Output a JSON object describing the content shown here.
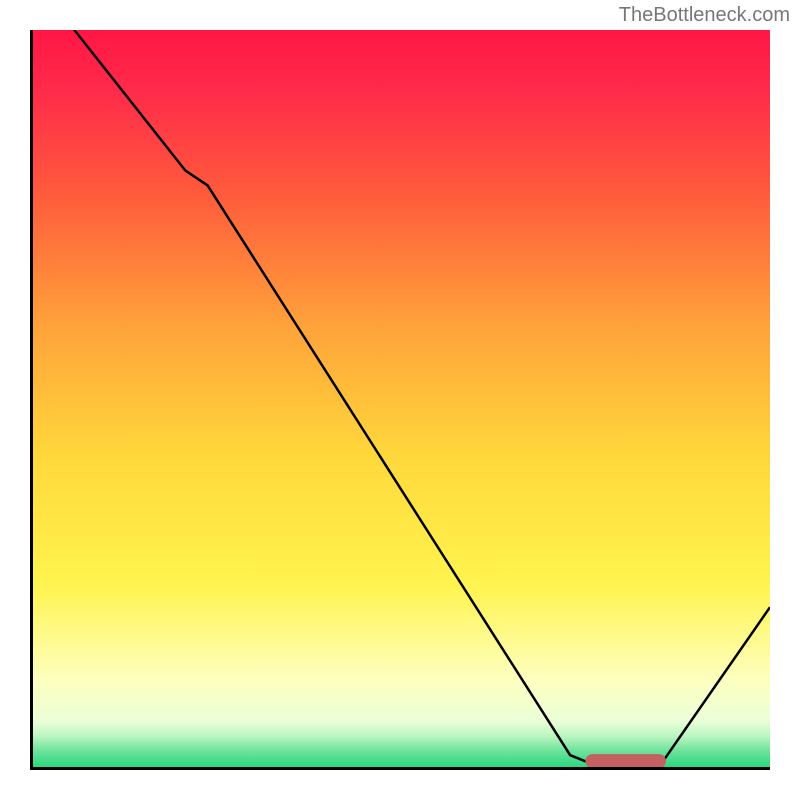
{
  "watermark": "TheBottleneck.com",
  "chart_data": {
    "type": "line",
    "title": "",
    "xlabel": "",
    "ylabel": "",
    "xlim": [
      0,
      100
    ],
    "ylim": [
      0,
      100
    ],
    "series": [
      {
        "name": "curve",
        "x": [
          0,
          6,
          21,
          24,
          73,
          78,
          84,
          85,
          100
        ],
        "values": [
          107,
          100,
          81,
          79,
          2,
          0,
          0,
          0.4,
          22
        ]
      }
    ],
    "marker": {
      "x_start": 76,
      "x_end": 85,
      "y": 1.2
    },
    "background_gradient": {
      "stops": [
        {
          "offset": 0.0,
          "color": "#ff1744"
        },
        {
          "offset": 0.08,
          "color": "#ff2a4a"
        },
        {
          "offset": 0.22,
          "color": "#ff5a3c"
        },
        {
          "offset": 0.4,
          "color": "#ffa23a"
        },
        {
          "offset": 0.58,
          "color": "#ffd93b"
        },
        {
          "offset": 0.75,
          "color": "#fff44f"
        },
        {
          "offset": 0.88,
          "color": "#fdffc0"
        },
        {
          "offset": 0.935,
          "color": "#eaffd8"
        },
        {
          "offset": 0.955,
          "color": "#b8f5c0"
        },
        {
          "offset": 0.975,
          "color": "#6be29a"
        },
        {
          "offset": 1.0,
          "color": "#1fd67a"
        }
      ]
    }
  }
}
